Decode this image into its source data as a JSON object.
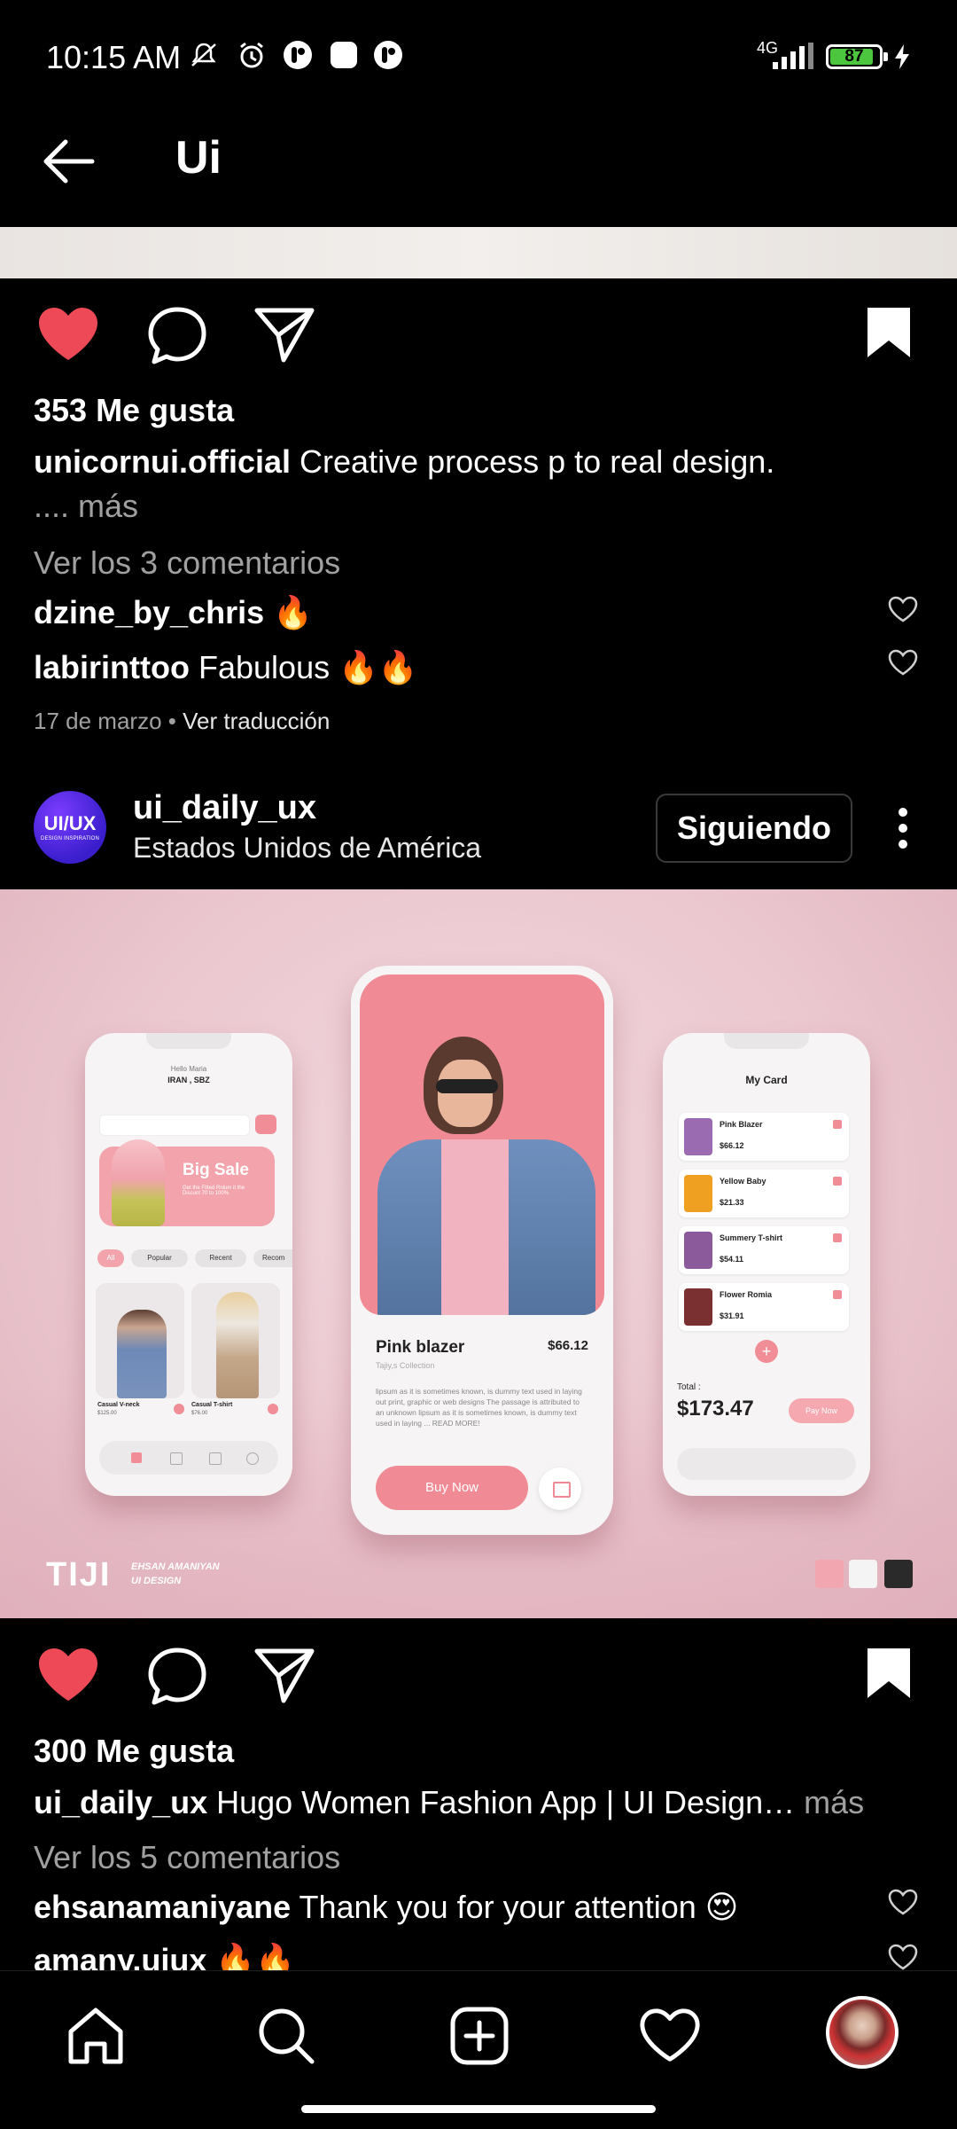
{
  "status_bar": {
    "time": "10:15 AM",
    "network": "4G",
    "battery": "87",
    "icons": [
      "mute-icon",
      "alarm-icon",
      "app-icon",
      "app-icon",
      "app-icon"
    ]
  },
  "header": {
    "title": "Ui"
  },
  "post1": {
    "likes": "353 Me gusta",
    "username": "unicornui.official",
    "caption": "Creative process p to real design.",
    "more": ".... más",
    "view_comments": "Ver los 3 comentarios",
    "comments": [
      {
        "user": "dzine_by_chris",
        "text": "🔥"
      },
      {
        "user": "labirinttoo",
        "text": "Fabulous 🔥🔥"
      }
    ],
    "date": "17 de marzo",
    "separator": "•",
    "translate": "Ver traducción",
    "liked": true,
    "saved": true
  },
  "post2": {
    "avatar_main": "UI/UX",
    "avatar_sub": "DESIGN INSPIRATION",
    "username": "ui_daily_ux",
    "location": "Estados Unidos de América",
    "follow_label": "Siguiendo",
    "likes": "300 Me gusta",
    "caption_user": "ui_daily_ux",
    "caption": "Hugo Women Fashion App | UI Design…",
    "more": "más",
    "view_comments": "Ver los 5 comentarios",
    "comments": [
      {
        "user": "ehsanamaniyane",
        "text": "Thank you for your attention 😍"
      },
      {
        "user": "amany.uiux",
        "text": "🔥🔥"
      }
    ],
    "liked": true,
    "saved": true,
    "image": {
      "left_phone": {
        "greeting": "Hello Maria",
        "location": "IRAN , SBZ",
        "banner_title": "Big Sale",
        "banner_sub": "Get the Fitted Rnlum it the Discunt 70 to 100%",
        "filters": [
          "All",
          "Popular",
          "Recent",
          "Recom"
        ],
        "products": [
          {
            "name": "Casual V-neck",
            "price": "$125.00"
          },
          {
            "name": "Casual T-shirt",
            "price": "$76.00"
          }
        ]
      },
      "center_phone": {
        "product": "Pink blazer",
        "price": "$66.12",
        "collection": "Tajiy,s Collection",
        "description": "lipsum as it is sometimes known, is dummy text used in laying out print, graphic or web designs The passage is attributed to an unknown lipsum as it is sometimes known, is dummy text used in laying ... READ MORE!",
        "buy_label": "Buy Now"
      },
      "right_phone": {
        "title": "My Card",
        "items": [
          {
            "name": "Pink Blazer",
            "price": "$66.12",
            "color": "#9a6bb0"
          },
          {
            "name": "Yellow Baby",
            "price": "$21.33",
            "color": "#f0a020"
          },
          {
            "name": "Summery T-shirt",
            "price": "$54.11",
            "color": "#8a5a9a"
          },
          {
            "name": "Flower Romia",
            "price": "$31.91",
            "color": "#7a3030"
          }
        ],
        "total_label": "Total :",
        "total": "$173.47",
        "pay_label": "Pay Now"
      },
      "brand": "TIJI",
      "designer": "EHSAN AMANIYAN",
      "designer_role": "UI DESIGN",
      "swatches": [
        "#f2a7b0",
        "#f4f4f4",
        "#2a2a2a"
      ]
    }
  },
  "bottom_nav": [
    "home-icon",
    "search-icon",
    "create-icon",
    "activity-icon",
    "profile-avatar"
  ],
  "colors": {
    "like_red": "#ed4956",
    "accent_pink": "#f08d97"
  }
}
